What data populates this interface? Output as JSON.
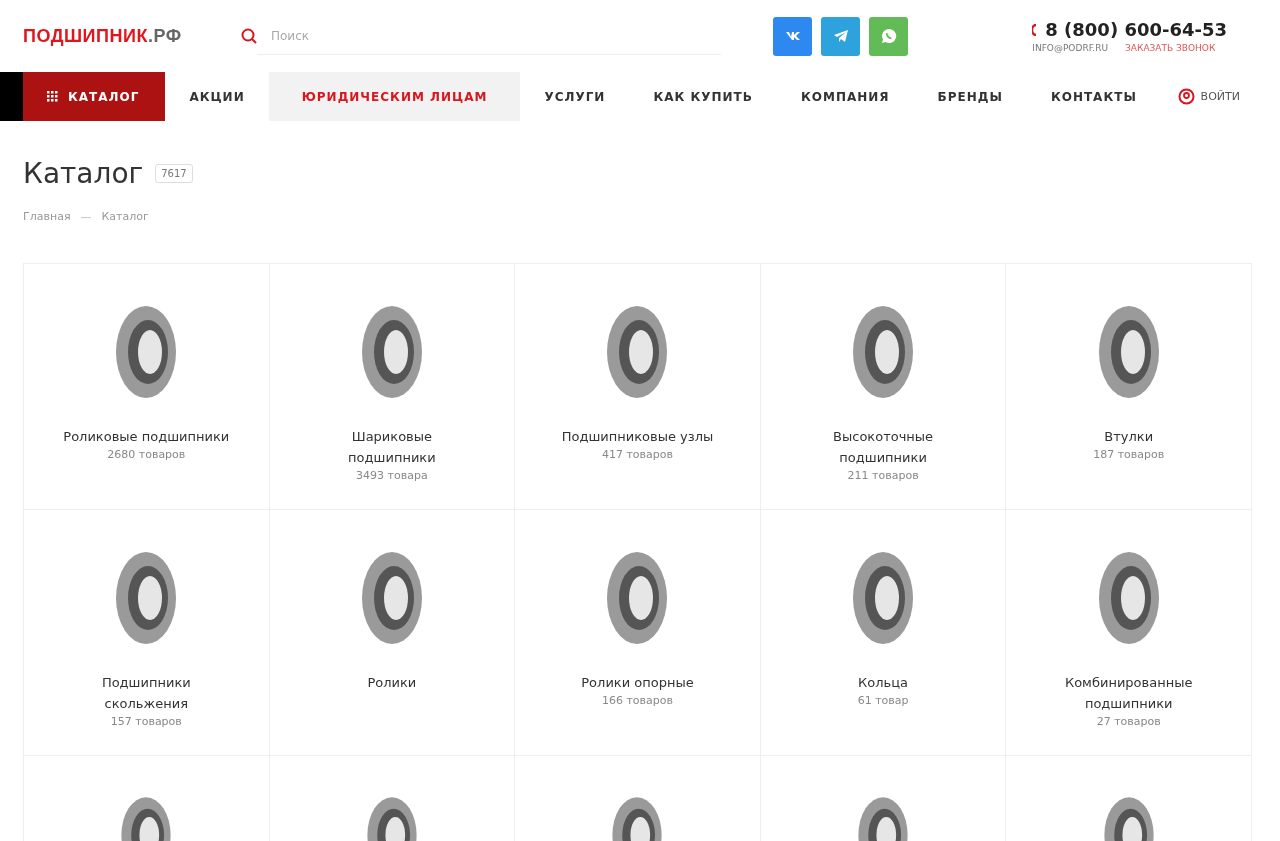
{
  "header": {
    "logo": {
      "main": "ПОДШИПНИК",
      "suffix": ".РФ"
    },
    "search": {
      "placeholder": "Поиск"
    },
    "socials": [
      {
        "kind": "vk",
        "color": "#2d88f0"
      },
      {
        "kind": "telegram",
        "color": "#2ea2dc"
      },
      {
        "kind": "whatsapp",
        "color": "#63bb58"
      }
    ],
    "phone": "8 (800) 600-64-53",
    "email": "INFO@PODRF.RU",
    "callback": "ЗАКАЗАТЬ ЗВОНОК"
  },
  "nav": {
    "items": [
      {
        "label": "КАТАЛОГ",
        "kind": "catalog"
      },
      {
        "label": "АКЦИИ",
        "kind": "plain"
      },
      {
        "label": "ЮРИДИЧЕСКИМ ЛИЦАМ",
        "kind": "highlight"
      },
      {
        "label": "УСЛУГИ",
        "kind": "plain"
      },
      {
        "label": "КАК КУПИТЬ",
        "kind": "plain"
      },
      {
        "label": "КОМПАНИЯ",
        "kind": "plain"
      },
      {
        "label": "БРЕНДЫ",
        "kind": "plain"
      },
      {
        "label": "КОНТАКТЫ",
        "kind": "plain"
      }
    ],
    "login": "ВОЙТИ"
  },
  "page": {
    "title": "Каталог",
    "count": "7617",
    "breadcrumbs": [
      "Главная",
      "Каталог"
    ],
    "breadcrumb_separator": "—"
  },
  "categories": [
    {
      "name": "Роликовые подшипники",
      "count": "2680 товаров"
    },
    {
      "name": "Шариковые подшипники",
      "count": "3493 товара"
    },
    {
      "name": "Подшипниковые узлы",
      "count": "417 товаров"
    },
    {
      "name": "Высокоточные подшипники",
      "count": "211 товаров"
    },
    {
      "name": "Втулки",
      "count": "187 товаров"
    },
    {
      "name": "Подшипники скольжения",
      "count": "157 товаров"
    },
    {
      "name": "Ролики"
    },
    {
      "name": "Ролики опорные",
      "count": "166 товаров"
    },
    {
      "name": "Кольца",
      "count": "61 товар"
    },
    {
      "name": "Комбинированные подшипники",
      "count": "27 товаров"
    },
    {
      "kind": "cut_off"
    },
    {
      "kind": "cut_off"
    },
    {
      "kind": "cut_off"
    },
    {
      "kind": "cut_off"
    },
    {
      "kind": "cut_off"
    }
  ]
}
